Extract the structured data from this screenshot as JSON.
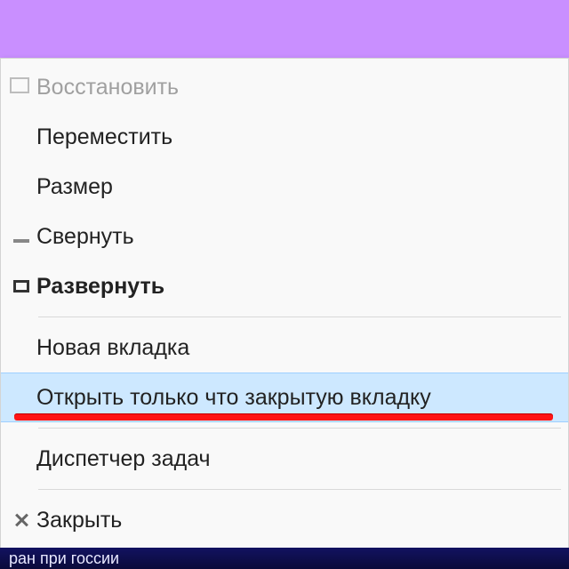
{
  "menu": {
    "items": [
      {
        "id": "restore",
        "label": "Восстановить",
        "icon": "restore-icon",
        "disabled": true
      },
      {
        "id": "move",
        "label": "Переместить"
      },
      {
        "id": "size",
        "label": "Размер"
      },
      {
        "id": "minimize",
        "label": "Свернуть",
        "icon": "minimize-icon"
      },
      {
        "id": "maximize",
        "label": "Развернуть",
        "icon": "maximize-icon",
        "bold": true
      }
    ],
    "items2": [
      {
        "id": "new-tab",
        "label": "Новая вкладка"
      },
      {
        "id": "reopen-tab",
        "label": "Открыть только что закрытую вкладку",
        "highlight": true
      }
    ],
    "items3": [
      {
        "id": "task-mgr",
        "label": "Диспетчер задач"
      }
    ],
    "items4": [
      {
        "id": "close",
        "label": "Закрыть",
        "icon": "close-icon"
      }
    ]
  },
  "background_snippet": "ран при госсии"
}
